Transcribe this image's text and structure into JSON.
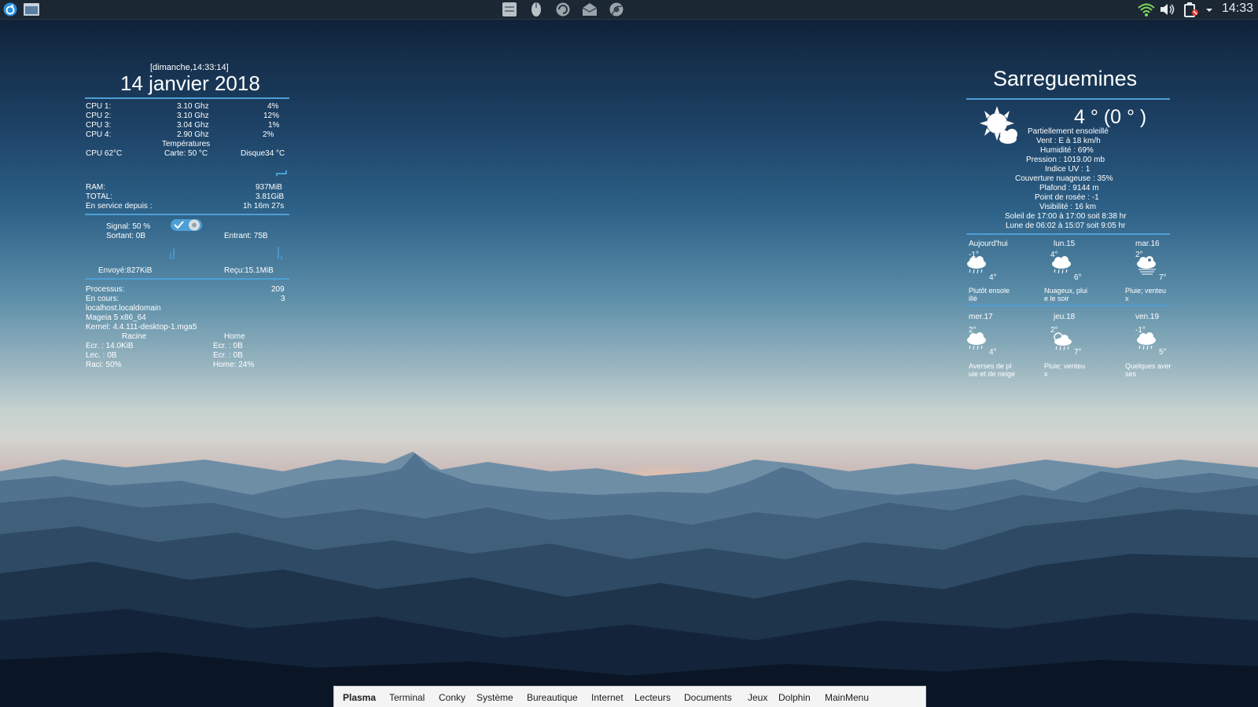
{
  "top_panel": {
    "launchers": [
      "kde-menu-icon",
      "desktop-show-icon"
    ],
    "apps": [
      "file-manager-icon",
      "mouse-settings-icon",
      "updater-icon",
      "mail-icon",
      "browser-icon"
    ],
    "tray": [
      "wifi-icon",
      "volume-icon",
      "battery-icon",
      "tray-expand-icon"
    ],
    "clock": "14:33"
  },
  "conky_left": {
    "datetime": "[dimanche,14:33:14]",
    "date": "14 janvier 2018",
    "cpus": [
      {
        "label": "CPU 1:",
        "freq": "3.10 Ghz",
        "usage": "4%"
      },
      {
        "label": "CPU 2:",
        "freq": "3.10 Ghz",
        "usage": "12%"
      },
      {
        "label": "CPU 3:",
        "freq": "3.04 Ghz",
        "usage": "1%"
      },
      {
        "label": "CPU 4:",
        "freq": "2.90 Ghz",
        "usage": "2%"
      }
    ],
    "temps_title": "Températures",
    "temp_cpu": "CPU 62°C",
    "temp_card": "Carte: 50 °C",
    "temp_disk": "Disque34 °C",
    "ram_label": "RAM:",
    "ram_value": "937MiB",
    "total_label": "TOTAL:",
    "total_value": "3.81GiB",
    "uptime_label": "En service depuis :",
    "uptime_value": "1h 16m 27s",
    "signal": "Signal: 50 %",
    "out_label": "Sortant: 0B",
    "in_label": "Entrant: 75B",
    "sent": "Envoyé:827KiB",
    "received": "Reçu:15.1MiB",
    "processes_label": "Processus:",
    "processes_value": "209",
    "running_label": "En cours:",
    "running_value": "3",
    "hostname": "localhost.localdomain",
    "distro": "Mageia 5 x86_64",
    "kernel": "Kernel: 4.4.111-desktop-1.mga5",
    "root_title": "Racine",
    "home_title": "Home",
    "root_write": "Ecr. : 14.0KiB",
    "root_read": "Lec. : 0B",
    "root_usage": "Raci:  50%",
    "home_write": "Ecr. : 0B",
    "home_read": "Ecr. : 0B",
    "home_usage": "Home: 24%"
  },
  "weather": {
    "city": "Sarreguemines",
    "temp": "4 °  (0 ° )",
    "condition": "Partiellement ensoleillé",
    "details": [
      "Vent : E à 18 km/h",
      "Humidité : 69%",
      "Pression : 1019.00 mb",
      "Indice UV : 1",
      "Couverture nuageuse : 35%",
      "Plafond : 9144 m",
      "Point de rosée : -1",
      "Visibilité : 16 km",
      "Soleil de 17:00 à 17:00 soit 8:38 hr",
      "Lune de 06:02 à 15:07 soit 9:05 hr"
    ],
    "forecast": [
      {
        "day": "Aujourd'hui",
        "low": "-1°",
        "high": "4°",
        "desc1": "Plutôt ensole",
        "desc2": "illé"
      },
      {
        "day": "lun.15",
        "low": "4°",
        "high": "6°",
        "desc1": "Nuageux, plui",
        "desc2": "e le soir"
      },
      {
        "day": "mar.16",
        "low": "2°",
        "high": "7°",
        "desc1": "Pluie; venteu",
        "desc2": "x"
      },
      {
        "day": "mer.17",
        "low": "2°",
        "high": "4°",
        "desc1": "Averses de pl",
        "desc2": "uie et de neige"
      },
      {
        "day": "jeu.18",
        "low": "2°",
        "high": "7°",
        "desc1": "Pluie; venteu",
        "desc2": "x"
      },
      {
        "day": "ven.19",
        "low": "-1°",
        "high": "5°",
        "desc1": "Quelques aver",
        "desc2": "ses"
      }
    ]
  },
  "bottom_menu": {
    "items": [
      "Plasma",
      "Terminal",
      "Conky",
      "Système",
      "Bureautique",
      "Internet",
      "Lecteurs",
      "Documents",
      "Jeux",
      "Dolphin",
      "MainMenu"
    ]
  },
  "colors": {
    "accent": "#4d9fd6",
    "panel": "#1b2733"
  }
}
